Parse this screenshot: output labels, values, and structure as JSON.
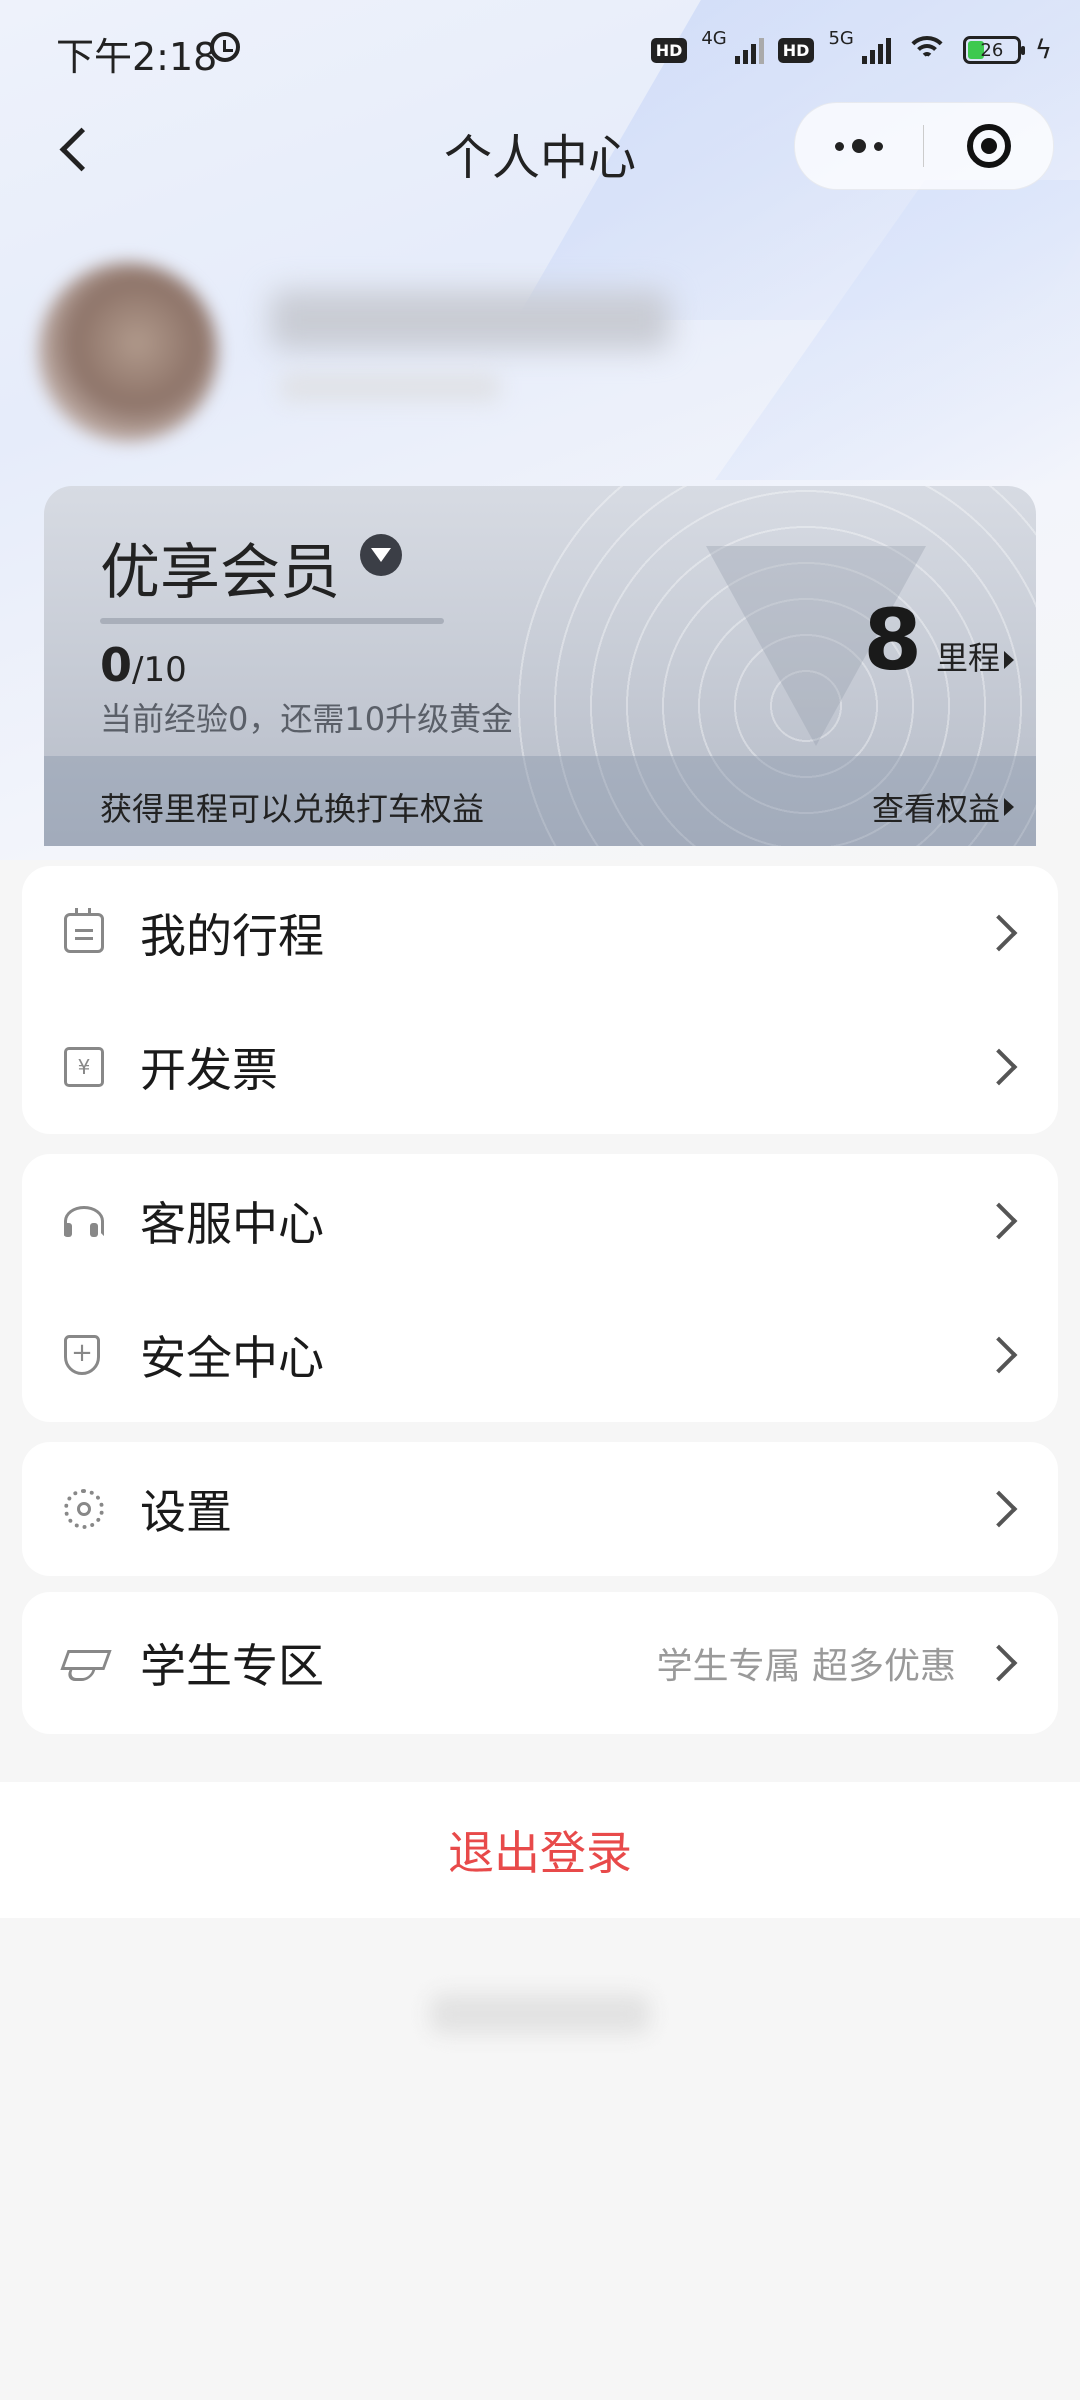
{
  "status_bar": {
    "time": "下午2:18",
    "hd1": "HD",
    "net1": "4G",
    "hd2": "HD",
    "net2": "5G",
    "battery": "26"
  },
  "nav": {
    "title": "个人中心"
  },
  "member_card": {
    "level": "优享会员",
    "exp_current": "0",
    "exp_total": "/10",
    "progress": 0,
    "exp_desc": "当前经验0，还需10升级黄金",
    "mileage_value": "8",
    "mileage_unit": "里程",
    "footer_text": "获得里程可以兑换打车权益",
    "benefits_link": "查看权益"
  },
  "menu": {
    "trips": "我的行程",
    "invoice": "开发票",
    "customer_service": "客服中心",
    "safety": "安全中心",
    "settings": "设置",
    "student": "学生专区",
    "student_hint": "学生专属 超多优惠"
  },
  "logout": "退出登录",
  "icons": {
    "back": "back-arrow-icon",
    "more": "more-dots-icon",
    "close": "close-target-icon",
    "trips": "calendar-icon",
    "invoice": "invoice-ticket-icon",
    "customer_service": "headset-icon",
    "safety": "shield-plus-icon",
    "settings": "gear-icon",
    "student": "graduation-cap-icon"
  },
  "colors": {
    "logout": "#e84a4a",
    "battery_fill": "#3dc94f"
  }
}
